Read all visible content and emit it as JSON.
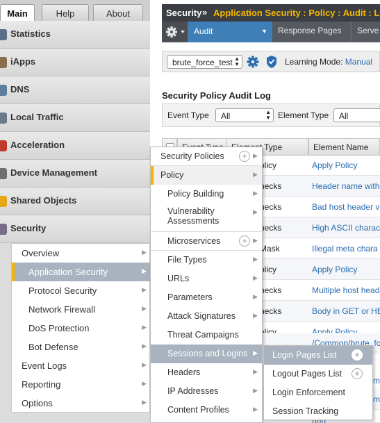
{
  "tabs": [
    "Main",
    "Help",
    "About"
  ],
  "nav": [
    {
      "label": "Statistics",
      "icon": "statistics-icon",
      "color": "#5b6f8a"
    },
    {
      "label": "iApps",
      "icon": "iapps-icon",
      "color": "#8a6d4f"
    },
    {
      "label": "DNS",
      "icon": "dns-icon",
      "color": "#5f7f9f"
    },
    {
      "label": "Local Traffic",
      "icon": "local-traffic-icon",
      "color": "#6a7a8a"
    },
    {
      "label": "Acceleration",
      "icon": "acceleration-icon",
      "color": "#c0392b"
    },
    {
      "label": "Device Management",
      "icon": "device-management-icon",
      "color": "#6f6f6f"
    },
    {
      "label": "Shared Objects",
      "icon": "shared-objects-icon",
      "color": "#e6a817"
    },
    {
      "label": "Security",
      "icon": "security-icon",
      "color": "#7a6a8a"
    }
  ],
  "security_submenu": [
    "Overview",
    "Application Security",
    "Protocol Security",
    "Network Firewall",
    "DoS Protection",
    "Bot Defense",
    "Event Logs",
    "Reporting",
    "Options"
  ],
  "header": {
    "section": "Security",
    "separator": "»",
    "path": "Application Security : Policy : Audit : Log"
  },
  "subbar": {
    "active": "Audit",
    "tabs": [
      "Response Pages",
      "Serve"
    ]
  },
  "policy": {
    "name": "brute_force_test",
    "learning_label": "Learning Mode:",
    "learning_value": "Manual"
  },
  "log": {
    "title": "Security Policy Audit Log",
    "event_type_label": "Event Type",
    "event_type_value": "All",
    "element_type_label": "Element Type",
    "element_type_value": "All",
    "columns": [
      "Event Type",
      "Element Type",
      "Element Name"
    ],
    "rows": [
      {
        "element_type": "olicy",
        "element_name": "Apply Policy"
      },
      {
        "element_type": "hecks",
        "element_name": "Header name with"
      },
      {
        "element_type": "hecks",
        "element_name": "Bad host header v"
      },
      {
        "element_type": "hecks",
        "element_name": "High ASCII charac"
      },
      {
        "element_type": "Mask",
        "element_name": "Illegal meta chara"
      },
      {
        "element_type": "olicy",
        "element_name": "Apply Policy"
      },
      {
        "element_type": "hecks",
        "element_name": "Multiple host head"
      },
      {
        "element_type": "hecks",
        "element_name": "Body in GET or HE"
      },
      {
        "element_type": "olicy",
        "element_name": "Apply Policy"
      },
      {
        "element_type": "",
        "element_name": "/Common/brute_fo"
      },
      {
        "element_type": "",
        "element_name": "m"
      },
      {
        "element_type": "",
        "element_name": "m"
      },
      {
        "element_type": "",
        "element_name": "nnn"
      }
    ]
  },
  "menu_l1": [
    {
      "label": "Security Policies",
      "plus": true
    },
    {
      "label": "Policy",
      "arrow": true,
      "current": true
    },
    {
      "label": "Policy Building",
      "arrow": true
    },
    {
      "label": "Vulnerability Assessments",
      "arrow": true
    },
    {
      "label": "Microservices",
      "plus": true
    },
    {
      "label": "File Types",
      "arrow": true
    },
    {
      "label": "URLs",
      "arrow": true
    },
    {
      "label": "Parameters",
      "arrow": true
    },
    {
      "label": "Attack Signatures",
      "arrow": true
    },
    {
      "label": "Threat Campaigns"
    },
    {
      "label": "Sessions and Logins",
      "arrow": true,
      "selected": true
    },
    {
      "label": "Headers",
      "arrow": true
    },
    {
      "label": "IP Addresses",
      "arrow": true
    },
    {
      "label": "Content Profiles",
      "arrow": true
    }
  ],
  "menu_l2": [
    {
      "label": "Login Pages List",
      "plus": true,
      "selected": true
    },
    {
      "label": "Logout Pages List",
      "plus": true
    },
    {
      "label": "Login Enforcement"
    },
    {
      "label": "Session Tracking"
    }
  ],
  "colors": {
    "accent": "#f4b400",
    "selected": "#a9b3bf",
    "link": "#2a6cb0",
    "header": "#3a3d42"
  }
}
